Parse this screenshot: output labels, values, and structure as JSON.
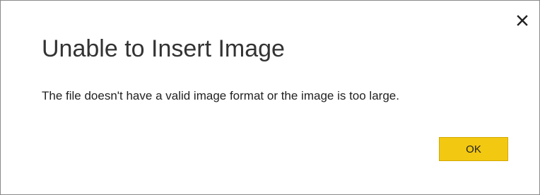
{
  "dialog": {
    "title": "Unable to Insert Image",
    "message": "The file doesn't have a valid image format or the image is too large.",
    "ok_label": "OK",
    "close_icon": "close-icon"
  },
  "colors": {
    "ok_button": "#f2c811",
    "title_text": "#333333",
    "border": "#8a8a8a"
  }
}
